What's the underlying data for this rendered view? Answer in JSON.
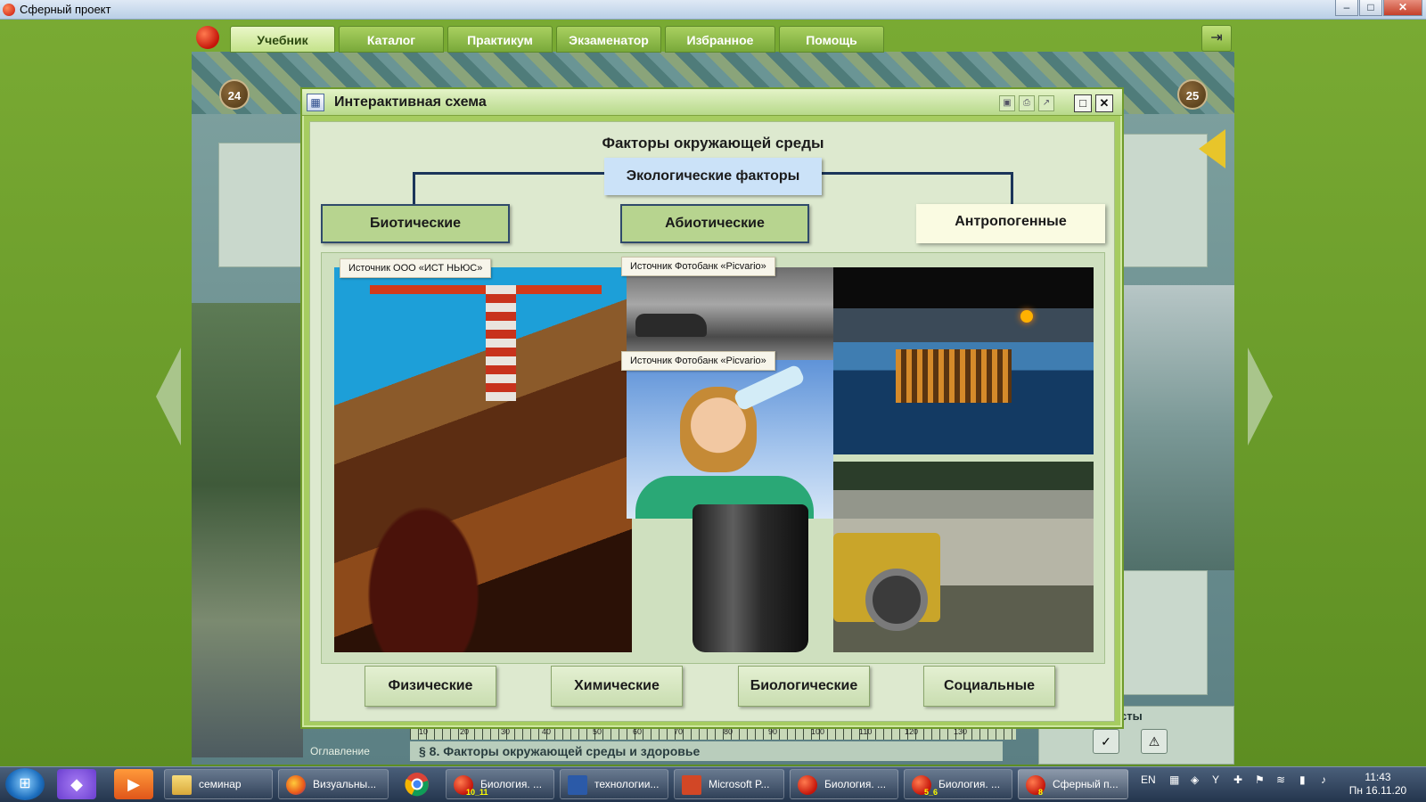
{
  "window": {
    "title": "Сферный проект",
    "minimize": "–",
    "maximize": "□",
    "close": "✕"
  },
  "menu": {
    "tabs": [
      {
        "label": "Учебник"
      },
      {
        "label": "Каталог"
      },
      {
        "label": "Практикум"
      },
      {
        "label": "Экзаменатор"
      },
      {
        "label": "Избранное"
      },
      {
        "label": "Помощь"
      }
    ],
    "active_tab": "Учебник"
  },
  "book": {
    "left_page_number": "24",
    "right_page_number": "25",
    "toc_label": "Оглавление",
    "chapter_title": "§ 8. Факторы окружающей среды и здоровье",
    "tests_label": "сты",
    "ruler_ticks": [
      "10",
      "20",
      "30",
      "40",
      "50",
      "60",
      "70",
      "80",
      "90",
      "100",
      "110",
      "120",
      "130"
    ]
  },
  "dialog": {
    "title": "Интерактивная схема",
    "scheme_title": "Факторы окружающей среды",
    "root": "Экологические факторы",
    "categories": [
      {
        "label": "Биотические"
      },
      {
        "label": "Абиотические"
      },
      {
        "label": "Антропогенные"
      }
    ],
    "captions": [
      "Источник ООО «ИСТ НЬЮС»",
      "Источник Фотобанк «Picvario»",
      "Источник Фотобанк «Picvario»"
    ],
    "subcategories": [
      {
        "label": "Физические"
      },
      {
        "label": "Химические"
      },
      {
        "label": "Биологические"
      },
      {
        "label": "Социальные"
      }
    ]
  },
  "taskbar": {
    "items": [
      {
        "label": "семинар",
        "icon": "folder-icon"
      },
      {
        "label": "Визуальны...",
        "icon": "firefox-icon"
      },
      {
        "label": "Биология. ...",
        "icon": "apple-icon",
        "badge": "10_11"
      },
      {
        "label": "технологии...",
        "icon": "word-icon"
      },
      {
        "label": "Microsoft P...",
        "icon": "powerpoint-icon"
      },
      {
        "label": "Биология. ...",
        "icon": "apple-icon"
      },
      {
        "label": "Биология. ...",
        "icon": "apple-icon",
        "badge": "5_6"
      },
      {
        "label": "Сферный п...",
        "icon": "apple-icon",
        "badge": "8"
      }
    ],
    "language": "EN",
    "time": "11:43",
    "date": "Пн 16.11.20"
  }
}
